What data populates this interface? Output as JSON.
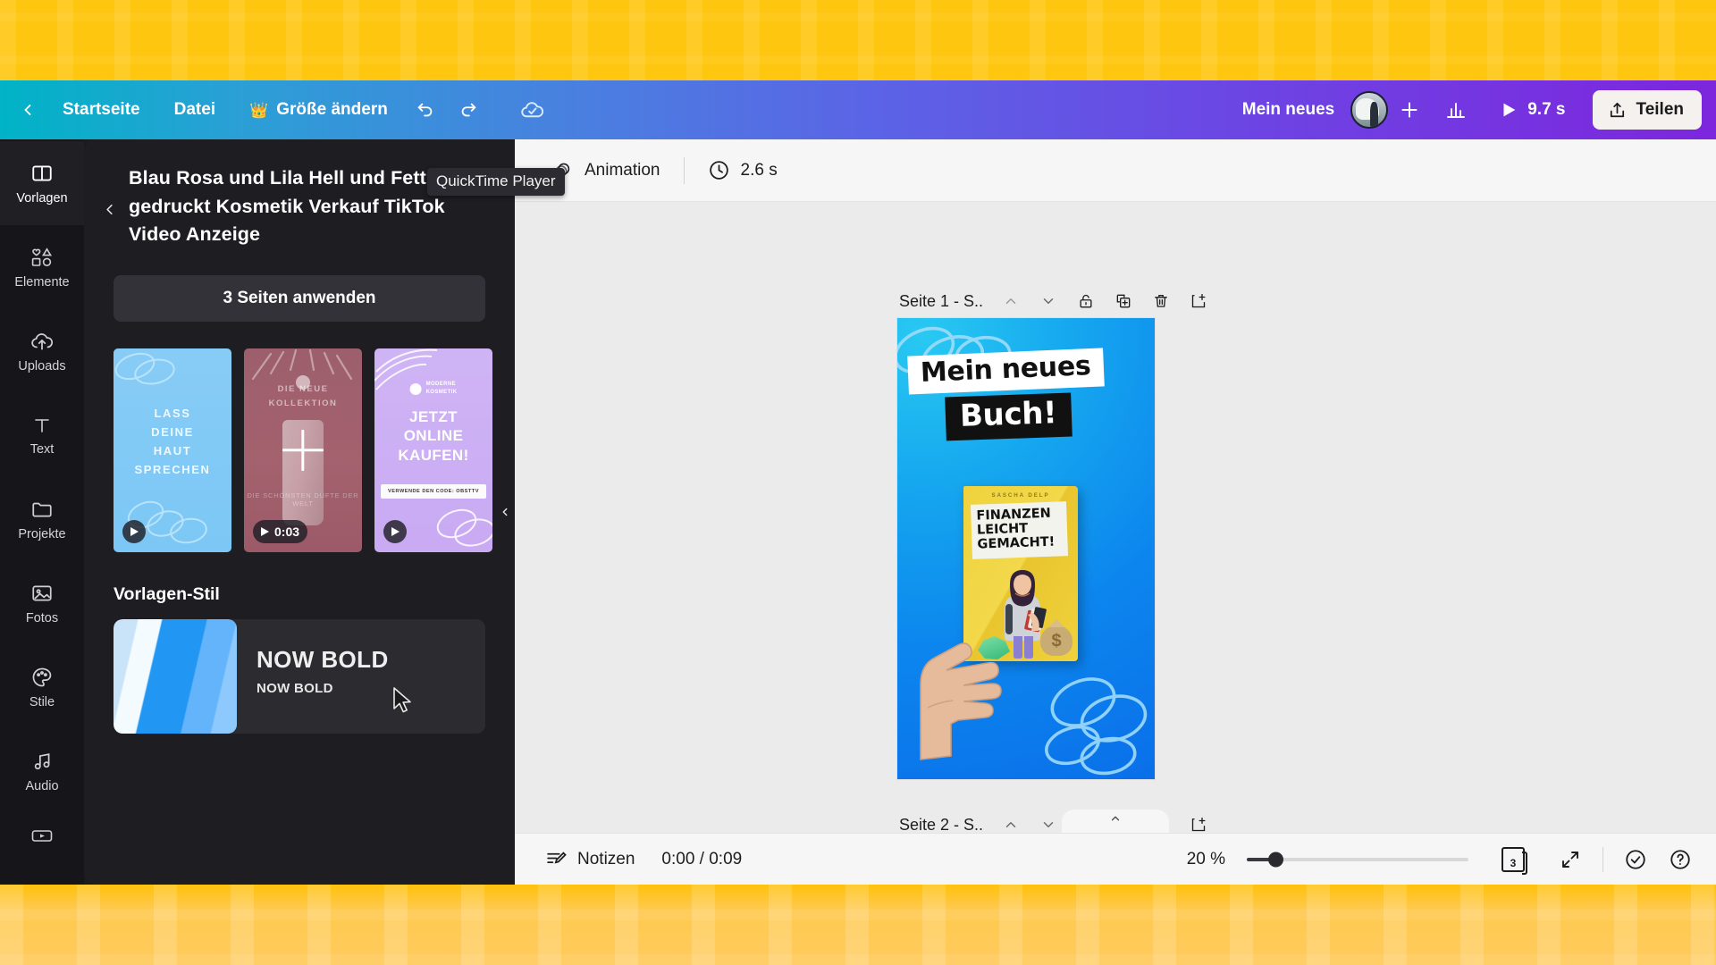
{
  "app": {
    "topbar": {
      "back_icon": "chevron-left-icon",
      "home_label": "Startseite",
      "file_label": "Datei",
      "resize_label": "Größe ändern",
      "crown_icon": "crown-icon",
      "undo_icon": "undo-icon",
      "redo_icon": "redo-icon",
      "cloud_saved_icon": "cloud-check-icon",
      "tooltip": "QuickTime Player",
      "doc_title": "Mein neues",
      "avatar": "user-avatar",
      "add_collaborator_icon": "plus-icon",
      "insights_icon": "bar-chart-icon",
      "play_icon": "play-icon",
      "duration_label": "9.7 s",
      "share_label": "Teilen",
      "share_icon": "upload-icon",
      "gradient_start": "#00b3c6",
      "gradient_end": "#7d26dd"
    },
    "rail": {
      "items": [
        {
          "label": "Vorlagen",
          "icon": "templates-icon",
          "active": true
        },
        {
          "label": "Elemente",
          "icon": "shapes-icon",
          "active": false
        },
        {
          "label": "Uploads",
          "icon": "cloud-upload-icon",
          "active": false
        },
        {
          "label": "Text",
          "icon": "text-icon",
          "active": false
        },
        {
          "label": "Projekte",
          "icon": "folder-icon",
          "active": false
        },
        {
          "label": "Fotos",
          "icon": "photo-icon",
          "active": false
        },
        {
          "label": "Stile",
          "icon": "palette-icon",
          "active": false
        },
        {
          "label": "Audio",
          "icon": "music-note-icon",
          "active": false
        },
        {
          "label": "",
          "icon": "video-icon",
          "active": false
        }
      ]
    },
    "panel": {
      "back_icon": "chevron-left-icon",
      "title": "Blau Rosa und Lila Hell und Fett gedruckt Kosmetik Verkauf TikTok Video Anzeige",
      "apply_label": "3 Seiten anwenden",
      "thumbnails": [
        {
          "name": "template-page-1",
          "text": "LASS\nDEINE\nHAUT\nSPRECHEN",
          "duration": "",
          "bg": "#7cc7f5"
        },
        {
          "name": "template-page-2",
          "header": "DIE NEUE\nKOLLEKTION",
          "subtext": "DIE SCHÖNSTEN DÜFTE DER WELT",
          "duration": "0:03",
          "bg": "#a4616e",
          "overlay_icon": "plus-icon"
        },
        {
          "name": "template-page-3",
          "brand": "MODERNE\nKOSMETIK",
          "text": "JETZT\nONLINE\nKAUFEN!",
          "code": "VERWENDE DEN CODE: OBSTTV",
          "duration": "",
          "bg": "#c9aaf3"
        }
      ],
      "style_section_label": "Vorlagen-Stil",
      "style_card": {
        "name": "NOW BOLD",
        "subname": "NOW BOLD",
        "swatch_colors": [
          "#c9e3f8",
          "#f4fbff",
          "#2196f3",
          "#63b4fb",
          "#8ec9fd"
        ]
      },
      "collapse_icon": "chevron-left-icon"
    },
    "canvas_toolbar": {
      "animation_label": "Animation",
      "animation_icon": "animation-icon",
      "clock_icon": "clock-icon",
      "page_duration": "2.6 s"
    },
    "pages": [
      {
        "header_label": "Seite 1 - S..",
        "controls": [
          "chevron-up-icon",
          "chevron-down-icon",
          "lock-icon",
          "duplicate-icon",
          "trash-icon",
          "add-page-icon"
        ],
        "design": {
          "title_line1": "Mein neues",
          "title_line2": "Buch!",
          "book_author": "SASCHA DELP",
          "book_title": "FINANZEN LEICHT GEMACHT!",
          "bg_color": "#0e9bf0"
        }
      },
      {
        "header_label": "Seite 2 - S..",
        "controls": [
          "chevron-up-icon",
          "chevron-down-icon",
          "lock-icon",
          "duplicate-icon",
          "trash-icon",
          "add-page-icon"
        ],
        "design": {
          "bg_color": "#1cc0e8"
        }
      }
    ],
    "comment_fab_icon": "add-comment-icon",
    "scroll_chevron_icon": "chevron-up-icon",
    "bottombar": {
      "notes_label": "Notizen",
      "notes_icon": "notes-icon",
      "time_label": "0:00 / 0:09",
      "zoom_label": "20 %",
      "zoom_value": 20,
      "page_count": "3",
      "page_count_icon": "pages-icon",
      "fullscreen_icon": "expand-icon",
      "check_icon": "check-circle-icon",
      "help_icon": "help-circle-icon"
    }
  }
}
